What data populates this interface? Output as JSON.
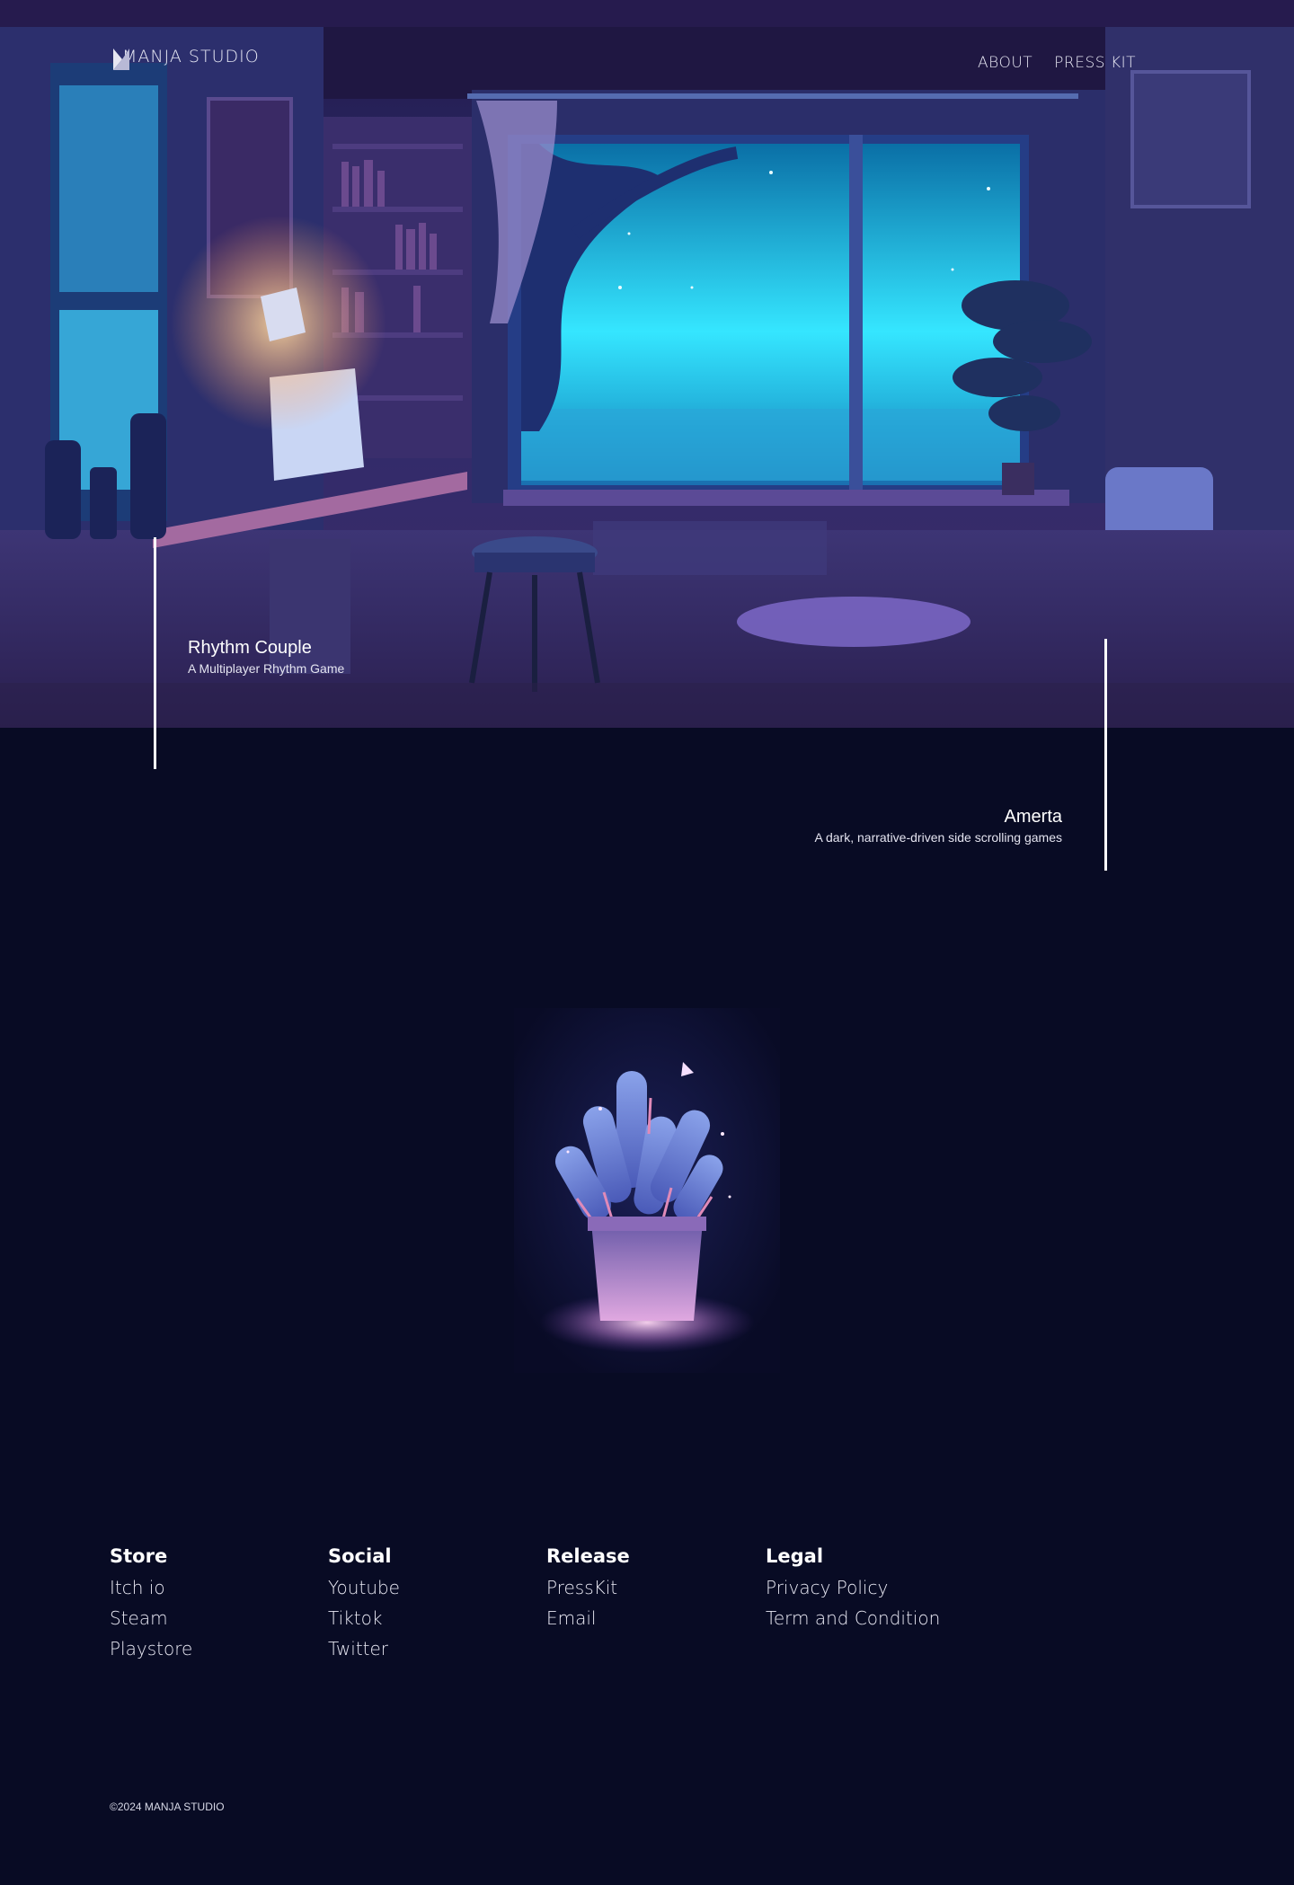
{
  "nav": {
    "brand": "MANJA STUDIO",
    "links": [
      {
        "label": "ABOUT"
      },
      {
        "label": "PRESS KIT"
      }
    ]
  },
  "games": [
    {
      "title": "Rhythm Couple",
      "subtitle": "A Multiplayer Rhythm Game"
    },
    {
      "title": "Amerta",
      "subtitle": "A dark, narrative-driven side scrolling games"
    }
  ],
  "footer": {
    "columns": [
      {
        "heading": "Store",
        "links": [
          "Itch io",
          "Steam",
          "Playstore"
        ]
      },
      {
        "heading": "Social",
        "links": [
          "Youtube",
          "Tiktok",
          "Twitter"
        ]
      },
      {
        "heading": "Release",
        "links": [
          "PressKit",
          "Email"
        ]
      },
      {
        "heading": "Legal",
        "links": [
          "Privacy Policy",
          "Term and Condition"
        ]
      }
    ],
    "copyright": "©2024 MANJA STUDIO"
  },
  "colors": {
    "background": "#080b24",
    "accent_cyan": "#3fe3ff",
    "accent_pink": "#e3a3e6"
  }
}
